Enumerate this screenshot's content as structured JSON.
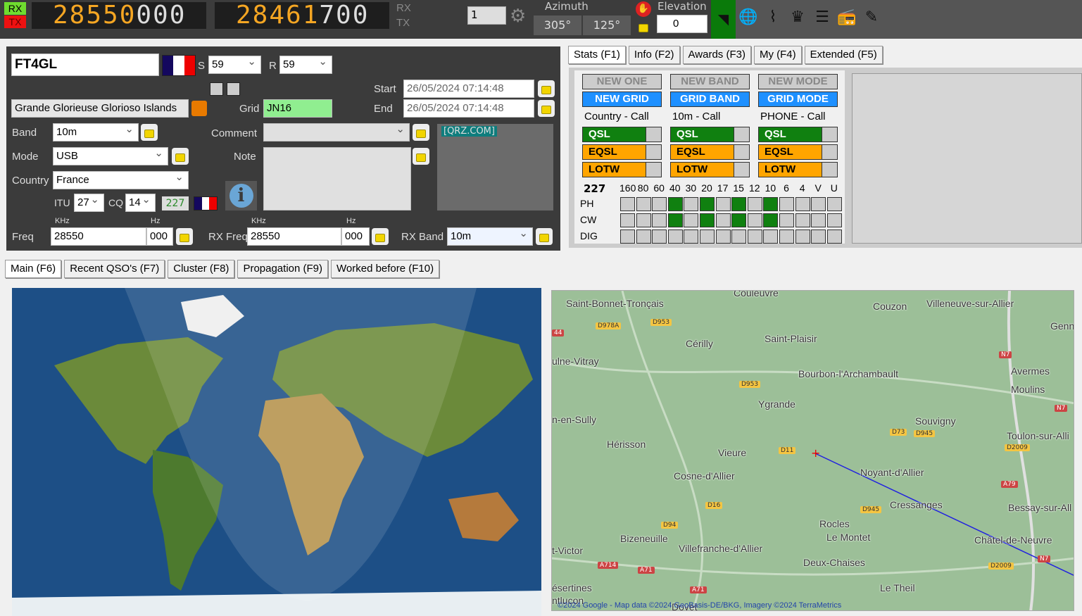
{
  "topbar": {
    "rx_label": "RX",
    "tx_label": "TX",
    "rx_freq_orange": "28550",
    "rx_freq_white": "000",
    "tx_freq_orange": "28461",
    "tx_freq_white": "700",
    "rx_side": "RX",
    "tx_side": "TX",
    "vfo_value": "1",
    "azimuth_label": "Azimuth",
    "azimuth_short": "305°",
    "azimuth_long": "125°",
    "elevation_label": "Elevation",
    "elevation_value": "0",
    "icons": [
      "rss-icon",
      "globe-icon",
      "telegraph-key-icon",
      "crown-icon",
      "server-icon",
      "radio-icon",
      "pen-icon"
    ]
  },
  "qso": {
    "callsign": "FT4GL",
    "s_label": "S",
    "s_value": "59",
    "r_label": "R",
    "r_value": "59",
    "name": "Grande Glorieuse Glorioso Islands",
    "grid_label": "Grid",
    "grid_value": "JN16",
    "start_label": "Start",
    "start_value": "26/05/2024 07:14:48",
    "end_label": "End",
    "end_value": "26/05/2024 07:14:48",
    "band_label": "Band",
    "band_value": "10m",
    "comment_label": "Comment",
    "comment_value": "",
    "mode_label": "Mode",
    "mode_value": "USB",
    "note_label": "Note",
    "note_value": "",
    "country_label": "Country",
    "country_value": "France",
    "itu_label": "ITU",
    "itu_value": "27",
    "cq_label": "CQ",
    "cq_value": "14",
    "dxcc": "227",
    "qrz_link": "[QRZ.COM]",
    "khz_label": "KHz",
    "hz_label": "Hz",
    "freq_label": "Freq",
    "freq_khz": "28550",
    "freq_hz": "000",
    "rxfreq_label": "RX Freq",
    "rxfreq_khz": "28550",
    "rxfreq_hz": "000",
    "rxband_label": "RX Band",
    "rxband_value": "10m"
  },
  "stats_tabs": [
    "Stats (F1)",
    "Info (F2)",
    "Awards (F3)",
    "My (F4)",
    "Extended (F5)"
  ],
  "stats": {
    "row1": [
      "NEW ONE",
      "NEW BAND",
      "NEW MODE"
    ],
    "row2": [
      "NEW GRID",
      "GRID BAND",
      "GRID MODE"
    ],
    "captions": [
      "Country - Call",
      "10m - Call",
      "PHONE - Call"
    ],
    "qsl": "QSL",
    "eqsl": "EQSL",
    "lotw": "LOTW",
    "dxcc": "227",
    "bands": [
      "160",
      "80",
      "60",
      "40",
      "30",
      "20",
      "17",
      "15",
      "12",
      "10",
      "6",
      "4",
      "V",
      "U"
    ],
    "modes": [
      {
        "name": "PH",
        "worked": [
          0,
          0,
          0,
          1,
          0,
          1,
          0,
          1,
          0,
          1,
          0,
          0,
          0,
          0
        ]
      },
      {
        "name": "CW",
        "worked": [
          0,
          0,
          0,
          1,
          0,
          1,
          0,
          1,
          0,
          1,
          0,
          0,
          0,
          0
        ]
      },
      {
        "name": "DIG",
        "worked": [
          0,
          0,
          0,
          0,
          0,
          0,
          0,
          0,
          0,
          0,
          0,
          0,
          0,
          0
        ]
      }
    ],
    "colors": {
      "green": "#108010",
      "orange": "#ffa500",
      "blue": "#1e90ff"
    }
  },
  "main_tabs": [
    "Main (F6)",
    "Recent QSO's (F7)",
    "Cluster (F8)",
    "Propagation (F9)",
    "Worked before (F10)"
  ],
  "map": {
    "towns": [
      "Couleuvre",
      "Saint-Bonnet-Tronçais",
      "Couzon",
      "Villeneuve-sur-Allier",
      "Genn",
      "Cérilly",
      "Saint-Plaisir",
      "ulne-Vitray",
      "Bourbon-l'Archambault",
      "Avermes",
      "Moulins",
      "Ygrande",
      "n-en-Sully",
      "Souvigny",
      "Toulon-sur-Alli",
      "Hérisson",
      "Vieure",
      "Noyant-d'Allier",
      "Cosne-d'Allier",
      "Cressanges",
      "Bessay-sur-All",
      "Rocles",
      "Le Montet",
      "Bizeneuille",
      "Villefranche-d'Allier",
      "Châtel-de-Neuvre",
      "t-Victor",
      "Deux-Chaises",
      "ésertines",
      "Le Theil",
      "ntlucon",
      "Doyet"
    ],
    "roads": [
      "D978A",
      "D953",
      "44",
      "D953",
      "N7",
      "N7",
      "D73",
      "D945",
      "D11",
      "D2009",
      "A79",
      "D16",
      "D945",
      "D94",
      "A714",
      "A71",
      "N7",
      "D2009",
      "A71"
    ],
    "attribution": "©2024 Google - Map data ©2024 GeoBasis-DE/BKG, Imagery ©2024 TerraMetrics"
  }
}
